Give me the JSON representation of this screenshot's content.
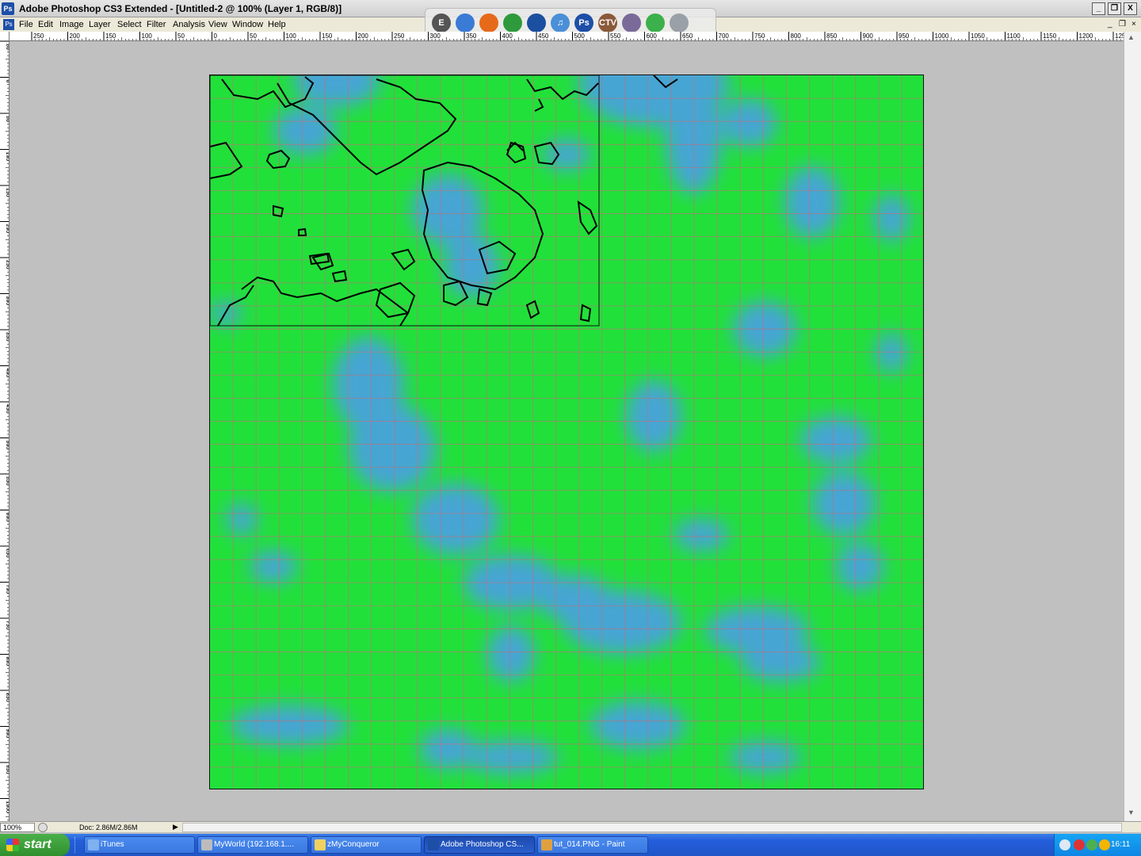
{
  "window": {
    "title": "Adobe Photoshop CS3 Extended - [Untitled-2 @ 100% (Layer 1, RGB/8)]",
    "app_icon": "Ps",
    "controls": {
      "minimize": "_",
      "maximize": "❐",
      "close": "X"
    }
  },
  "menu": {
    "items": [
      "File",
      "Edit",
      "Image",
      "Layer",
      "Select",
      "Filter",
      "Analysis",
      "View",
      "Window",
      "Help"
    ],
    "doc_icon": "Ps",
    "doc_controls": {
      "minimize": "_",
      "restore": "❐",
      "close": "×"
    }
  },
  "dock": {
    "items": [
      {
        "icon": "e-letters-icon",
        "label": "E",
        "color": "#555555"
      },
      {
        "icon": "network-icon",
        "label": "",
        "color": "#3a7bd5"
      },
      {
        "icon": "firefox-icon",
        "label": "",
        "color": "#e66a1a"
      },
      {
        "icon": "globe-icon",
        "label": "",
        "color": "#2e9a3c"
      },
      {
        "icon": "earth-icon",
        "label": "",
        "color": "#1b4fa0"
      },
      {
        "icon": "itunes-icon",
        "label": "♫",
        "color": "#4a8fd8"
      },
      {
        "icon": "photoshop-icon",
        "label": "Ps",
        "color": "#1e4fa7"
      },
      {
        "icon": "ctv-icon",
        "label": "CTV",
        "color": "#8a5a3a"
      },
      {
        "icon": "sims-icon",
        "label": "",
        "color": "#7a6a9a"
      },
      {
        "icon": "diamond-icon",
        "label": "",
        "color": "#3cb04a"
      },
      {
        "icon": "recycle-bin-icon",
        "label": "",
        "color": "#9aa0a8"
      }
    ]
  },
  "rulers": {
    "top_labels": [
      "250",
      "200",
      "150",
      "100",
      "50",
      "0",
      "50",
      "100",
      "150",
      "200",
      "250",
      "300",
      "350",
      "400",
      "450",
      "500",
      "550",
      "600",
      "650",
      "700",
      "750",
      "800",
      "850",
      "900",
      "950",
      "1000",
      "1050",
      "1100",
      "1150",
      "1200",
      "1250"
    ],
    "left_labels": [
      "50",
      "0",
      "50",
      "100",
      "150",
      "200",
      "250",
      "300",
      "350",
      "400",
      "450",
      "500",
      "550",
      "600",
      "650",
      "700",
      "750",
      "800",
      "850",
      "900",
      "950",
      "1000"
    ]
  },
  "canvas": {
    "background_color": "#22e03a",
    "water_color": "#4aa2dc",
    "grid_color": "#c0707a",
    "grid_cells": 31,
    "selection_outline": "black"
  },
  "status": {
    "zoom": "100%",
    "doc": "Doc: 2.86M/2.86M",
    "arrow": "▶"
  },
  "taskbar": {
    "start_label": "start",
    "tasks": [
      {
        "label": "iTunes",
        "icon": "itunes-icon",
        "color": "#7fb0f0",
        "active": false
      },
      {
        "label": "MyWorld (192.168.1....",
        "icon": "remote-desktop-icon",
        "color": "#bcbcbc",
        "active": false
      },
      {
        "label": "zMyConqueror",
        "icon": "folder-icon",
        "color": "#f0d060",
        "active": false
      },
      {
        "label": "Adobe Photoshop CS...",
        "icon": "photoshop-icon",
        "color": "#1e4fa7",
        "active": true
      },
      {
        "label": "tut_014.PNG - Paint",
        "icon": "paint-icon",
        "color": "#e0a040",
        "active": false
      }
    ],
    "clock": "16:11"
  }
}
